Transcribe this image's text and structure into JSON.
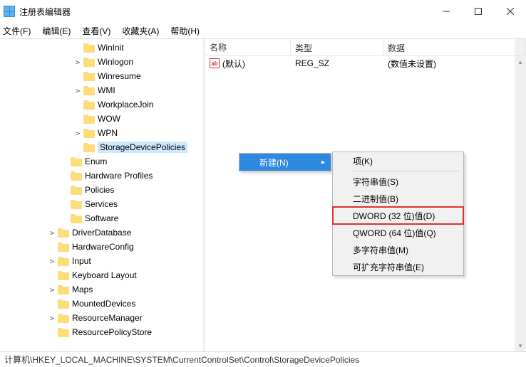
{
  "window": {
    "title": "注册表编辑器"
  },
  "menu": {
    "file": "文件(F)",
    "edit": "编辑(E)",
    "view": "查看(V)",
    "fav": "收藏夹(A)",
    "help": "帮助(H)"
  },
  "tree": [
    {
      "depth": 4,
      "exp": "none",
      "label": "WinInit"
    },
    {
      "depth": 4,
      "exp": "closed",
      "label": "Winlogon"
    },
    {
      "depth": 4,
      "exp": "none",
      "label": "Winresume"
    },
    {
      "depth": 4,
      "exp": "closed",
      "label": "WMI"
    },
    {
      "depth": 4,
      "exp": "none",
      "label": "WorkplaceJoin"
    },
    {
      "depth": 4,
      "exp": "none",
      "label": "WOW"
    },
    {
      "depth": 4,
      "exp": "closed",
      "label": "WPN"
    },
    {
      "depth": 4,
      "exp": "none",
      "label": "StorageDevicePolicies",
      "selected": true
    },
    {
      "depth": 3,
      "exp": "none",
      "label": "Enum"
    },
    {
      "depth": 3,
      "exp": "none",
      "label": "Hardware Profiles"
    },
    {
      "depth": 3,
      "exp": "none",
      "label": "Policies"
    },
    {
      "depth": 3,
      "exp": "none",
      "label": "Services"
    },
    {
      "depth": 3,
      "exp": "none",
      "label": "Software"
    },
    {
      "depth": 2,
      "exp": "closed",
      "label": "DriverDatabase"
    },
    {
      "depth": 2,
      "exp": "none",
      "label": "HardwareConfig"
    },
    {
      "depth": 2,
      "exp": "closed",
      "label": "Input"
    },
    {
      "depth": 2,
      "exp": "none",
      "label": "Keyboard Layout"
    },
    {
      "depth": 2,
      "exp": "closed",
      "label": "Maps"
    },
    {
      "depth": 2,
      "exp": "none",
      "label": "MountedDevices"
    },
    {
      "depth": 2,
      "exp": "closed",
      "label": "ResourceManager"
    },
    {
      "depth": 2,
      "exp": "none",
      "label": "ResourcePolicyStore"
    }
  ],
  "list": {
    "headers": {
      "name": "名称",
      "type": "类型",
      "data": "数据"
    },
    "rows": [
      {
        "name": "(默认)",
        "type": "REG_SZ",
        "data": "(数值未设置)"
      }
    ]
  },
  "context": {
    "main": [
      {
        "label": "新建(N)",
        "hi": true,
        "arrow": true
      }
    ],
    "sub": [
      {
        "label": "项(K)"
      },
      {
        "sep": true
      },
      {
        "label": "字符串值(S)"
      },
      {
        "label": "二进制值(B)"
      },
      {
        "label": "DWORD (32 位)值(D)",
        "red": true
      },
      {
        "label": "QWORD (64 位)值(Q)"
      },
      {
        "label": "多字符串值(M)"
      },
      {
        "label": "可扩充字符串值(E)"
      }
    ]
  },
  "status": {
    "path": "计算机\\HKEY_LOCAL_MACHINE\\SYSTEM\\CurrentControlSet\\Control\\StorageDevicePolicies"
  }
}
